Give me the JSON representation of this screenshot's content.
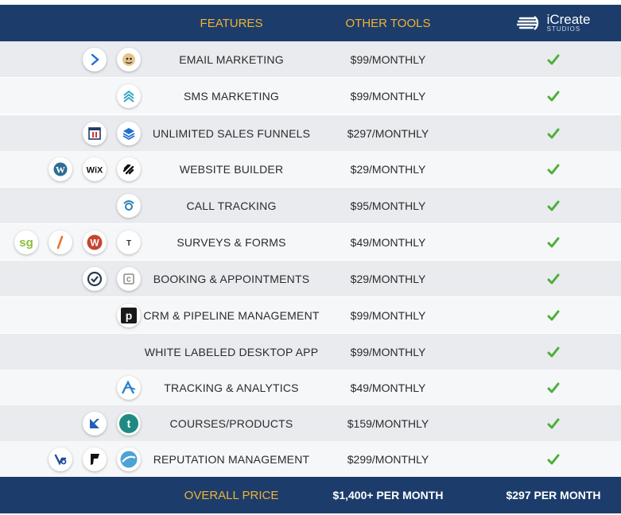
{
  "header": {
    "features_label": "FEATURES",
    "other_tools_label": "OTHER TOOLS",
    "brand_name": "iCreate",
    "brand_sub": "STUDIOS"
  },
  "rows": [
    {
      "feature": "EMAIL MARKETING",
      "price": "$99/MONTHLY",
      "icons": [
        "activecampaign-icon",
        "mailchimp-icon"
      ]
    },
    {
      "feature": "SMS MARKETING",
      "price": "$99/MONTHLY",
      "icons": [
        "sms-tool-icon"
      ]
    },
    {
      "feature": "UNLIMITED SALES FUNNELS",
      "price": "$297/MONTHLY",
      "icons": [
        "clickfunnels-icon",
        "stacks-icon"
      ]
    },
    {
      "feature": "WEBSITE BUILDER",
      "price": "$29/MONTHLY",
      "icons": [
        "wordpress-icon",
        "wix-icon",
        "squarespace-icon"
      ]
    },
    {
      "feature": "CALL TRACKING",
      "price": "$95/MONTHLY",
      "icons": [
        "call-tracking-icon"
      ]
    },
    {
      "feature": "SURVEYS & FORMS",
      "price": "$49/MONTHLY",
      "icons": [
        "surveygizmo-icon",
        "formstack-icon",
        "wufoo-icon",
        "typeform-icon"
      ]
    },
    {
      "feature": "BOOKING & APPOINTMENTS",
      "price": "$29/MONTHLY",
      "icons": [
        "acuity-icon",
        "calendly-icon"
      ]
    },
    {
      "feature": "CRM & PIPELINE MANAGEMENT",
      "price": "$99/MONTHLY",
      "icons": [
        "pipedrive-icon"
      ]
    },
    {
      "feature": "WHITE LABELED DESKTOP APP",
      "price": "$99/MONTHLY",
      "icons": []
    },
    {
      "feature": "TRACKING & ANALYTICS",
      "price": "$49/MONTHLY",
      "icons": [
        "analytics-icon"
      ]
    },
    {
      "feature": "COURSES/PRODUCTS",
      "price": "$159/MONTHLY",
      "icons": [
        "kajabi-icon",
        "teachable-icon"
      ]
    },
    {
      "feature": "REPUTATION MANAGEMENT",
      "price": "$299/MONTHLY",
      "icons": [
        "birdeye-icon",
        "foursquare-icon",
        "reputation-icon"
      ]
    }
  ],
  "footer": {
    "label": "OVERALL PRICE",
    "other_total": "$1,400+ PER MONTH",
    "icreate_total": "$297 PER MONTH"
  },
  "colors": {
    "header_bg": "#1c3d6b",
    "header_text": "#f2b233",
    "row_even": "#e9ebee",
    "row_odd": "#f6f7f8",
    "check": "#4caf3a"
  }
}
